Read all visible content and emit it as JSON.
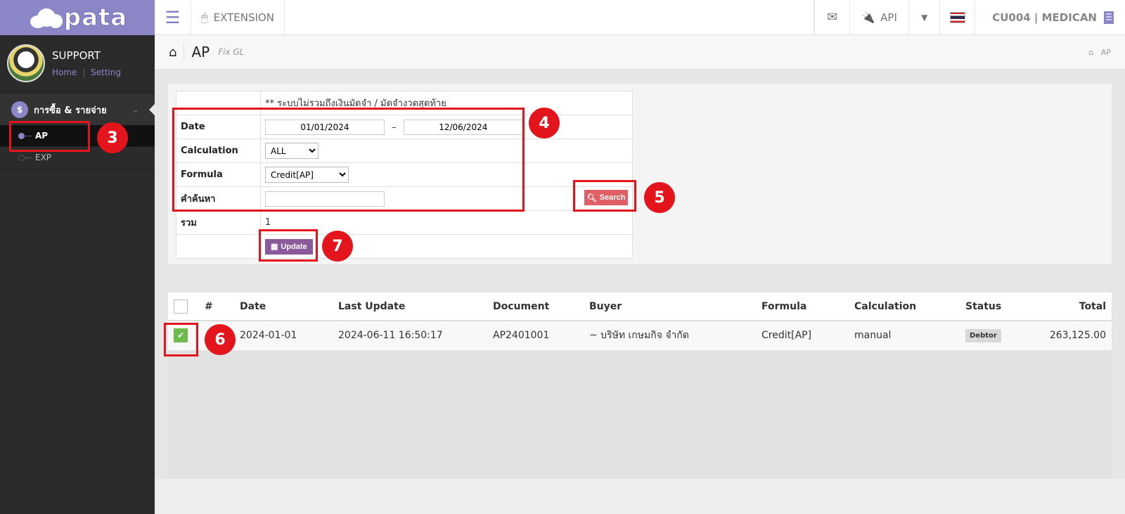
{
  "brand": {
    "logo_text": "pata"
  },
  "topbar": {
    "menu_icon": "hamburger-icon",
    "extension_label": "EXTENSION",
    "api_label": "API",
    "user_label": "CU004 | MEDICAN"
  },
  "sidebar": {
    "profile_name": "SUPPORT",
    "home_link": "Home",
    "separator": "|",
    "setting_link": "Setting",
    "group_label": "การซื้อ & รายจ่าย",
    "group_icon": "$",
    "items": [
      {
        "label": "AP",
        "active": true
      },
      {
        "label": "EXP",
        "active": false
      }
    ]
  },
  "page_header": {
    "title": "AP",
    "subtitle": "Fix GL",
    "breadcrumb": "AP"
  },
  "filter": {
    "note": "** ระบบไม่รวมถึงเงินมัดจำ / มัดจำงวดสุดท้าย",
    "date_label": "Date",
    "date_from": "01/01/2024",
    "date_sep": "–",
    "date_to": "12/06/2024",
    "calculation_label": "Calculation",
    "calculation_value": "ALL",
    "formula_label": "Formula",
    "formula_value": "Credit[AP]",
    "search_label": "คำค้นหา",
    "search_value": "",
    "total_label": "รวม",
    "total_value": "1",
    "search_button": "Search",
    "update_button": "Update"
  },
  "table": {
    "headers": [
      "#",
      "Date",
      "Last Update",
      "Document",
      "Buyer",
      "Formula",
      "Calculation",
      "Status",
      "Total"
    ],
    "rows": [
      {
        "checked": true,
        "num": "",
        "date": "2024-01-01",
        "last_update": "2024-06-11 16:50:17",
        "document": "AP2401001",
        "buyer": "~ บริษัท เกษมกิจ จำกัด",
        "formula": "Credit[AP]",
        "calculation": "manual",
        "status": "Debtor",
        "total": "263,125.00"
      }
    ]
  },
  "annotations": {
    "n3": "3",
    "n4": "4",
    "n5": "5",
    "n6": "6",
    "n7": "7"
  },
  "colors": {
    "brand": "#8b87c6",
    "highlight": "#e3141b",
    "search_button": "#e05f64",
    "update_button": "#8a5a9c",
    "checkbox_on": "#6dbb4b"
  }
}
